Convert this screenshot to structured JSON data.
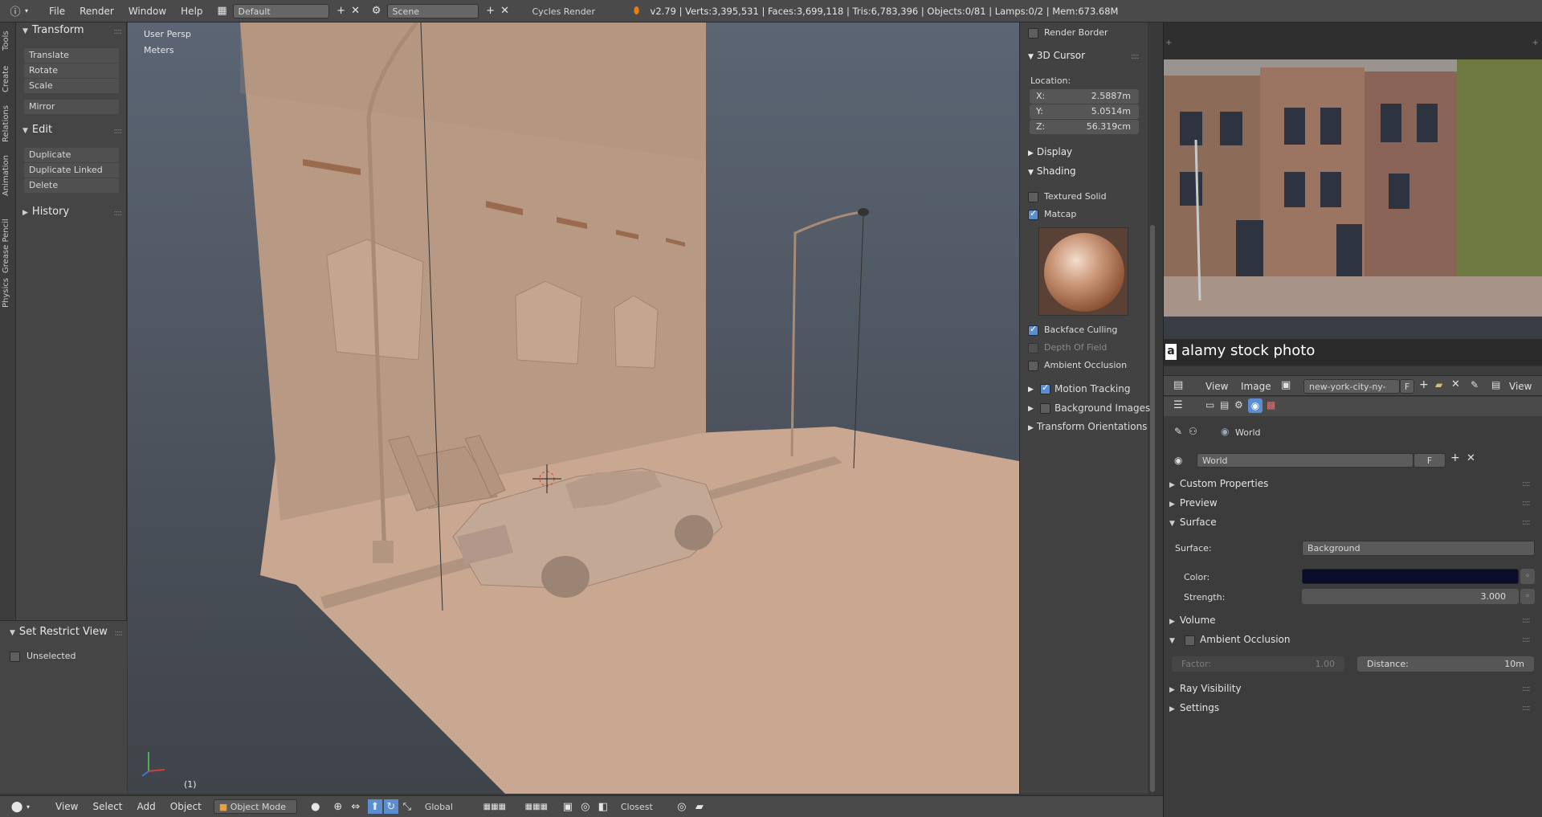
{
  "topbar": {
    "menus": [
      "File",
      "Render",
      "Window",
      "Help"
    ],
    "layout": "Default",
    "scene": "Scene",
    "engine": "Cycles Render",
    "stats": "v2.79 | Verts:3,395,531 | Faces:3,699,118 | Tris:6,783,396 | Objects:0/81 | Lamps:0/2 | Mem:673.68M"
  },
  "left_tabs": [
    "Tools",
    "Create",
    "Relations",
    "Animation",
    "Grease Pencil",
    "Physics"
  ],
  "toolshelf": {
    "transform": {
      "title": "Transform",
      "items": [
        "Translate",
        "Rotate",
        "Scale",
        "Mirror"
      ]
    },
    "edit": {
      "title": "Edit",
      "items": [
        "Duplicate",
        "Duplicate Linked",
        "Delete"
      ]
    },
    "history": {
      "title": "History"
    },
    "restrict": {
      "title": "Set Restrict View",
      "option": "Unselected"
    }
  },
  "viewport": {
    "view_name": "User Persp",
    "units": "Meters",
    "frame": "(1)"
  },
  "npanel": {
    "render_border": "Render Border",
    "cursor": {
      "title": "3D Cursor",
      "location_label": "Location:",
      "x_label": "X:",
      "x": "2.5887m",
      "y_label": "Y:",
      "y": "5.0514m",
      "z_label": "Z:",
      "z": "56.319cm"
    },
    "display": "Display",
    "shading": {
      "title": "Shading",
      "textured_solid": "Textured Solid",
      "matcap": "Matcap",
      "backface": "Backface Culling",
      "dof": "Depth Of Field",
      "ao": "Ambient Occlusion"
    },
    "motion_tracking": "Motion Tracking",
    "background_images": "Background Images",
    "transform_orientations": "Transform Orientations"
  },
  "image_editor": {
    "watermark_text": "alamy stock photo",
    "menu_view": "View",
    "menu_image": "Image",
    "image_name": "new-york-city-ny-us...",
    "image_flag": "F",
    "view_right": "View"
  },
  "properties": {
    "context": "World",
    "world_name": "World",
    "world_flag": "F",
    "panels": {
      "custom_properties": "Custom Properties",
      "preview": "Preview",
      "surface": "Surface",
      "volume": "Volume",
      "ambient_occlusion": "Ambient Occlusion",
      "ray_visibility": "Ray Visibility",
      "settings": "Settings"
    },
    "surface_label": "Surface:",
    "surface_value": "Background",
    "color_label": "Color:",
    "color_value": "#0b0b2a",
    "strength_label": "Strength:",
    "strength_value": "3.000",
    "factor_label": "Factor:",
    "factor_value": "1.00",
    "distance_label": "Distance:",
    "distance_value": "10m"
  },
  "bottombar": {
    "menus": [
      "View",
      "Select",
      "Add",
      "Object"
    ],
    "mode": "Object Mode",
    "orientation": "Global",
    "snap": "Closest"
  },
  "colors": {
    "header": "#4a4a4a",
    "accent_blue": "#5a8ed0",
    "model_tan": "#c9a791"
  }
}
